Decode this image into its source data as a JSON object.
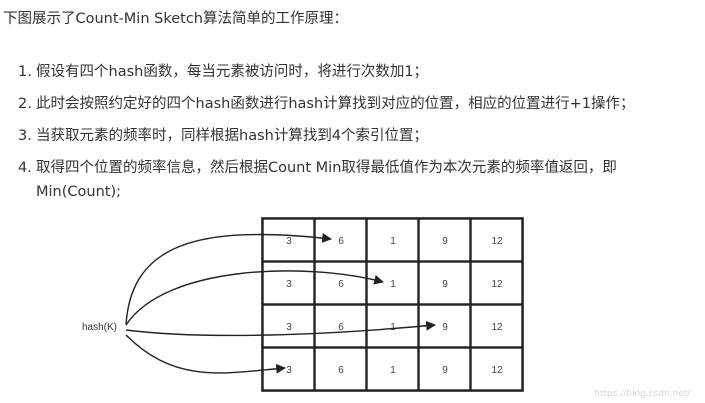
{
  "intro": "下图展示了Count-Min Sketch算法简单的工作原理：",
  "steps": [
    {
      "num": "1.",
      "text": "假设有四个hash函数，每当元素被访问时，将进行次数加1；",
      "cont": ""
    },
    {
      "num": "2.",
      "text": "此时会按照约定好的四个hash函数进行hash计算找到对应的位置，相应的位置进行+1操作；",
      "cont": ""
    },
    {
      "num": "3.",
      "text": "当获取元素的频率时，同样根据hash计算找到4个索引位置；",
      "cont": ""
    },
    {
      "num": "4.",
      "text": "取得四个位置的频率信息，然后根据Count Min取得最低值作为本次元素的频率值返回，即",
      "cont": "Min(Count);"
    }
  ],
  "diagram": {
    "hash_label": "hash(K)",
    "grid": [
      [
        "3",
        "6",
        "1",
        "9",
        "12"
      ],
      [
        "3",
        "6",
        "1",
        "9",
        "12"
      ],
      [
        "3",
        "6",
        "1",
        "9",
        "12"
      ],
      [
        "3",
        "6",
        "1",
        "9",
        "12"
      ]
    ],
    "arrow_targets": [
      {
        "row": 0,
        "col": 1
      },
      {
        "row": 1,
        "col": 2
      },
      {
        "row": 2,
        "col": 3
      },
      {
        "row": 3,
        "col": 0
      }
    ]
  },
  "watermark": "https://blog.csdn.net/..."
}
